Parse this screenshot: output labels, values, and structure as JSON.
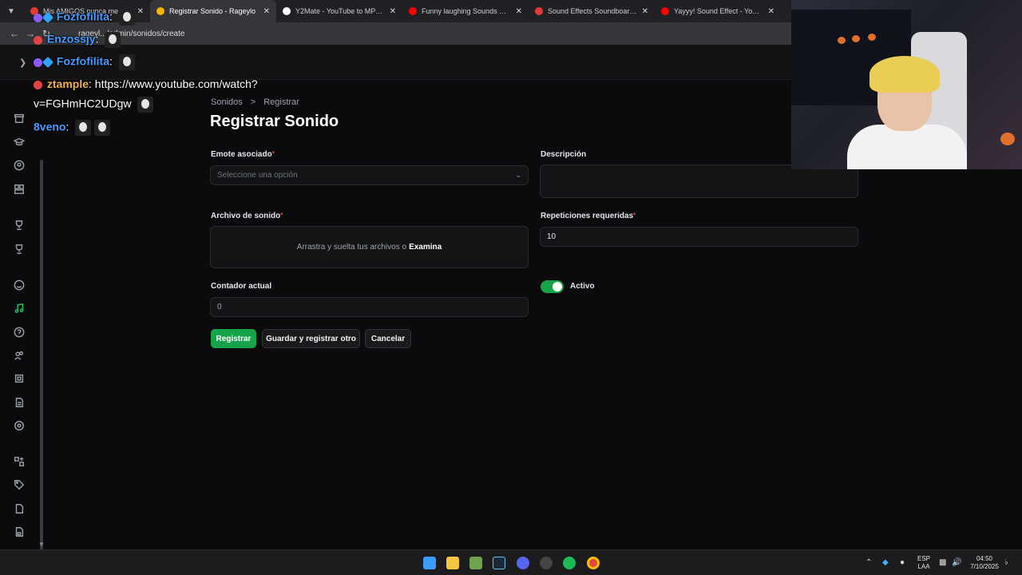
{
  "browser": {
    "tabs": [
      {
        "title": "Mis AMIGOS nunca me pidien",
        "fav": "#e53935",
        "active": false
      },
      {
        "title": "Registrar Sonido - Rageylo",
        "fav": "#f5b400",
        "active": true
      },
      {
        "title": "Y2Mate - YouTube to MP3 Con",
        "fav": "#ffffff",
        "active": false
      },
      {
        "title": "Funny laughing Sounds Effect",
        "fav": "#ff0000",
        "active": false
      },
      {
        "title": "Sound Effects Soundboard - Im",
        "fav": "#e53935",
        "active": false
      },
      {
        "title": "Yayyy! Sound Effect - YouTube",
        "fav": "#ff0000",
        "active": false
      }
    ],
    "url": "rageyl.../admin/sonidos/create"
  },
  "breadcrumb": {
    "root": "Sonidos",
    "sep": ">",
    "current": "Registrar"
  },
  "page": {
    "title": "Registrar Sonido"
  },
  "form": {
    "emote_label": "Emote asociado",
    "emote_placeholder": "Seleccione una opción",
    "descripcion_label": "Descripción",
    "descripcion_value": "",
    "archivo_label": "Archivo de sonido",
    "dropzone_text": "Arrastra y suelta tus archivos o",
    "dropzone_link": "Examina",
    "repeticiones_label": "Repeticiones requeridas",
    "repeticiones_value": "10",
    "contador_label": "Contador actual",
    "contador_value": "0",
    "activo_label": "Activo",
    "activo_on": true,
    "required_mark": "*"
  },
  "actions": {
    "registrar": "Registrar",
    "guardar_otro": "Guardar y registrar otro",
    "cancelar": "Cancelar"
  },
  "chat": [
    {
      "user": "Fozfofilita",
      "sep": ":",
      "msg": ""
    },
    {
      "user": "Enzossjy",
      "sep": ":",
      "msg": ""
    },
    {
      "user": "Fozfofilita",
      "sep": ":",
      "msg": ""
    },
    {
      "user": "ztample",
      "sep": ":",
      "msg": "https://www.youtube.com/watch?"
    },
    {
      "user": "",
      "sep": "",
      "msg": "v=FGHmHC2UDgw"
    },
    {
      "user": "8veno",
      "sep": ":",
      "msg": ""
    }
  ],
  "taskbar": {
    "lang": "ESP",
    "layout": "LAA",
    "time": "04:50",
    "date": "7/10/2025"
  },
  "colors": {
    "accent": "#16a34a",
    "background": "#0b0b0d"
  },
  "icons": [
    "chevron-down-icon",
    "back-arrow-icon",
    "forward-arrow-icon",
    "reload-icon",
    "close-icon",
    "music-note-icon",
    "windows-start-icon",
    "folder-icon",
    "steam-icon",
    "discord-icon",
    "spotify-icon",
    "chrome-icon"
  ]
}
